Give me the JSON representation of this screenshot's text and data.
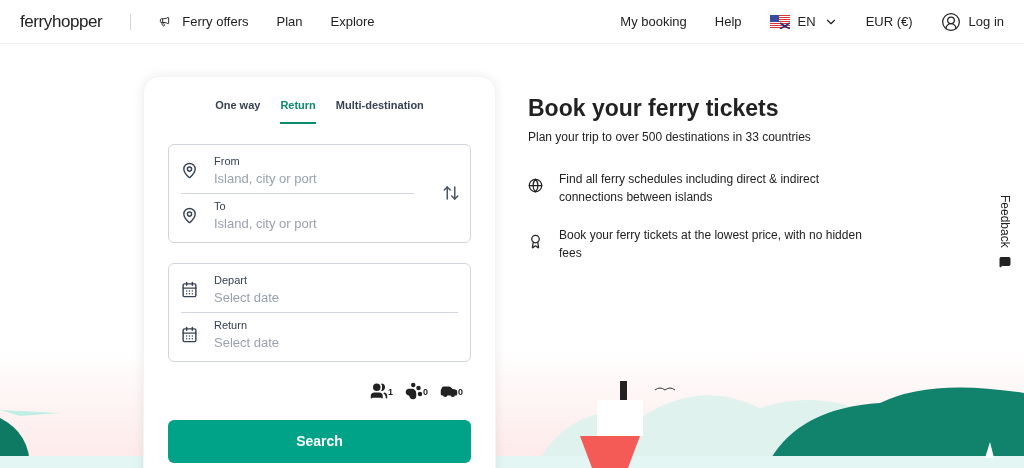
{
  "header": {
    "logo": "ferryhopper",
    "nav": [
      {
        "label": "Ferry offers"
      },
      {
        "label": "Plan"
      },
      {
        "label": "Explore"
      }
    ],
    "right": [
      {
        "kind": "link",
        "label": "My booking"
      },
      {
        "kind": "link",
        "label": "Help"
      },
      {
        "kind": "language",
        "label": "EN"
      },
      {
        "kind": "link",
        "label": "EUR (€)"
      },
      {
        "kind": "login",
        "label": "Log in"
      }
    ]
  },
  "search_card": {
    "tabs": [
      {
        "label": "One way",
        "selected": false
      },
      {
        "label": "Return",
        "selected": true
      },
      {
        "label": "Multi-destination",
        "selected": false
      }
    ],
    "route_fields": [
      {
        "label": "From",
        "placeholder": "Island, city or port"
      },
      {
        "label": "To",
        "placeholder": "Island, city or port"
      }
    ],
    "date_fields": [
      {
        "label": "Depart",
        "placeholder": "Select date"
      },
      {
        "label": "Return",
        "placeholder": "Select date"
      }
    ],
    "counters": [
      {
        "kind": "passengers",
        "count": "1"
      },
      {
        "kind": "pets",
        "count": "0"
      },
      {
        "kind": "vehicles",
        "count": "0"
      }
    ],
    "search_button": "Search"
  },
  "hero": {
    "title": "Book your ferry tickets",
    "subtitle": "Plan your trip to over 500 destinations in 33 countries",
    "features": [
      {
        "kind": "globe",
        "text": "Find all ferry schedules including direct & indirect connections between islands"
      },
      {
        "kind": "award",
        "text": "Book your ferry tickets at the lowest price, with no hidden fees"
      }
    ]
  },
  "feedback_tab": "Feedback"
}
